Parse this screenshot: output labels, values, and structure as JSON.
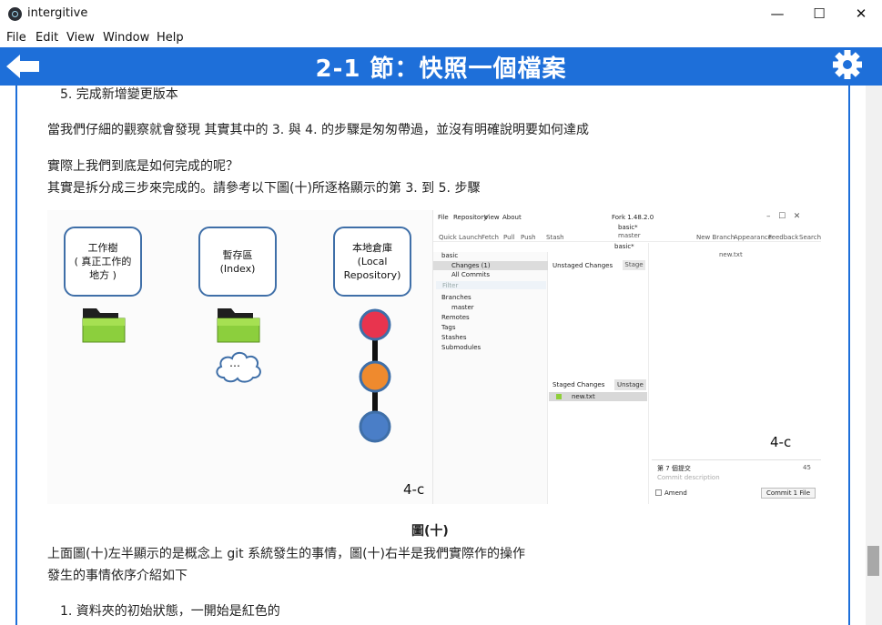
{
  "window": {
    "title": "intergitive",
    "minimize_glyph": "—",
    "maximize_glyph": "☐",
    "close_glyph": "✕"
  },
  "menu": [
    "File",
    "Edit",
    "View",
    "Window",
    "Help"
  ],
  "header": {
    "title": "2-1 節：快照一個檔案",
    "back_icon": "arrow-left-icon",
    "settings_icon": "gear-icon",
    "accent_color": "#1e6fd9"
  },
  "content": {
    "step5": "5. 完成新增變更版本",
    "para1": "當我們仔細的觀察就會發現 其實其中的 3. 與 4. 的步驟是匆匆帶過，並沒有明確說明要如何達成",
    "para2_line1": "實際上我們到底是如何完成的呢？",
    "para2_line2": "其實是拆分成三步來完成的。請參考以下圖(十)所逐格顯示的第 3. 到 5. 步驟",
    "caption": "圖(十)",
    "para3_line1": "上面圖(十)左半顯示的是概念上 git 系統發生的事情，圖(十)右半是我們實際作的操作",
    "para3_line2": "發生的事情依序介紹如下",
    "list1": "1. 資料夾的初始狀態，一開始是紅色的"
  },
  "figure": {
    "nodes": [
      {
        "line1": "工作樹",
        "line2": "( 真正工作的",
        "line3": "地方 )"
      },
      {
        "line1": "暫存區",
        "line2": "(Index)",
        "line3": ""
      },
      {
        "line1": "本地倉庫",
        "line2": "(Local",
        "line3": "Repository)"
      }
    ],
    "cloud_text": "…",
    "commit_colors": [
      "#e8344e",
      "#ef8a2e",
      "#4a7ec7"
    ],
    "left_label": "4-c",
    "right_label": "4-c",
    "fork": {
      "menu": [
        "File",
        "Repository",
        "View",
        "About"
      ],
      "app_title": "Fork 1.48.2.0",
      "toolbar": [
        "Quick Launch",
        "Fetch",
        "Pull",
        "Push",
        "Stash"
      ],
      "toolbar_right": [
        "New Branch",
        "Appearance",
        "Feedback",
        "Search"
      ],
      "repo_tab": "basic*",
      "branch_sub": "master",
      "repo_name": "basic",
      "changes": "Changes (1)",
      "all_commits": "All Commits",
      "filter": "Filter",
      "branches": "Branches",
      "master": "master",
      "remotes": "Remotes",
      "tags": "Tags",
      "stashes": "Stashes",
      "submodules": "Submodules",
      "unstaged": "Unstaged Changes",
      "stage": "Stage",
      "staged": "Staged Changes",
      "unstage": "Unstage",
      "file": "new.txt",
      "file_header": "new.txt",
      "commit_subject": "第 7 個提交",
      "commit_count": "45",
      "commit_desc": "Commit description",
      "amend": "Amend",
      "commit_btn": "Commit 1 File"
    }
  }
}
